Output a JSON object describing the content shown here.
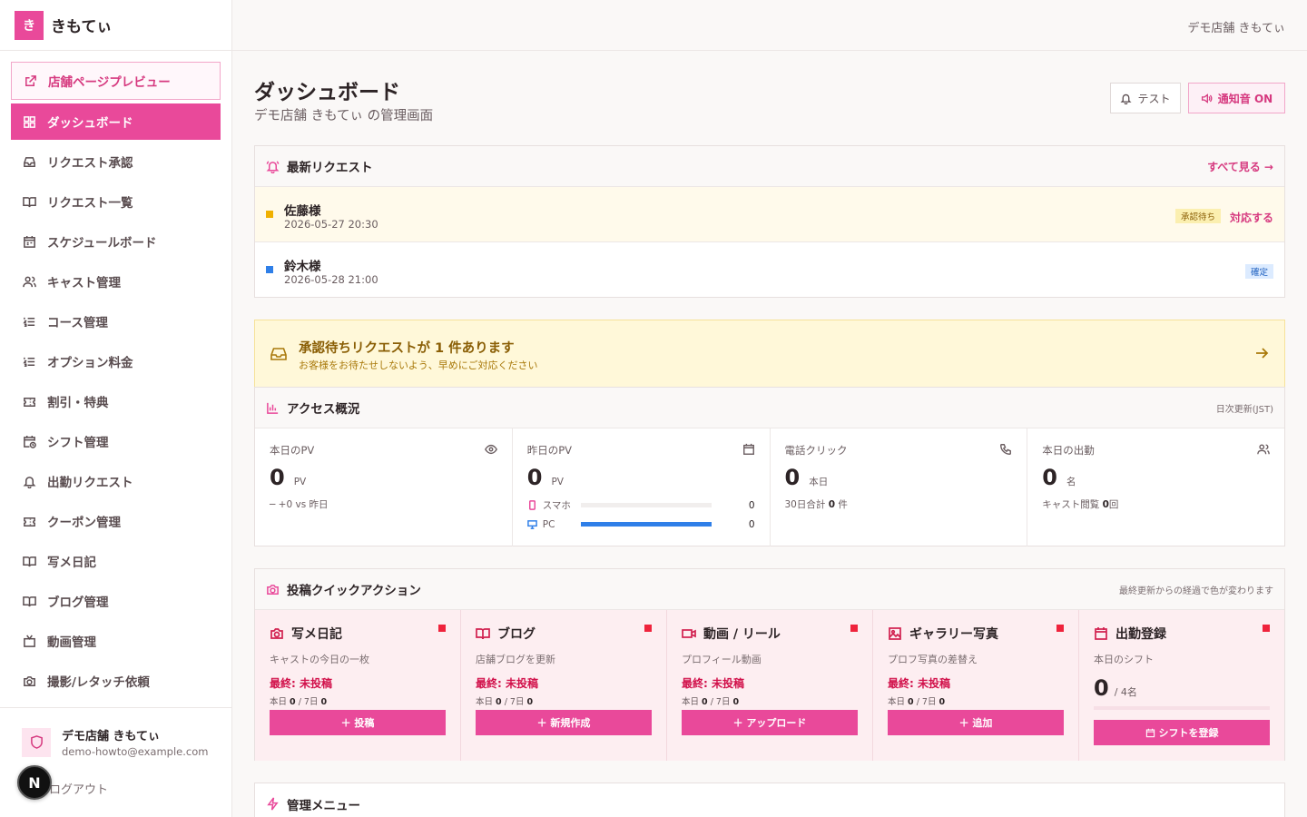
{
  "brand": {
    "logo_char": "き",
    "name": "きもてぃ"
  },
  "sidebar": {
    "items": [
      {
        "label": "店舗ページプレビュー",
        "icon": "external-link-icon"
      },
      {
        "label": "ダッシュボード",
        "icon": "grid-icon"
      },
      {
        "label": "リクエスト承認",
        "icon": "inbox-icon"
      },
      {
        "label": "リクエスト一覧",
        "icon": "book-icon"
      },
      {
        "label": "スケジュールボード",
        "icon": "calendar-icon"
      },
      {
        "label": "キャスト管理",
        "icon": "users-icon"
      },
      {
        "label": "コース管理",
        "icon": "list-icon"
      },
      {
        "label": "オプション料金",
        "icon": "list-icon"
      },
      {
        "label": "割引・特典",
        "icon": "ticket-icon"
      },
      {
        "label": "シフト管理",
        "icon": "calendar-clock-icon"
      },
      {
        "label": "出勤リクエスト",
        "icon": "bell-icon"
      },
      {
        "label": "クーポン管理",
        "icon": "ticket-icon"
      },
      {
        "label": "写メ日記",
        "icon": "book-icon"
      },
      {
        "label": "ブログ管理",
        "icon": "book-icon"
      },
      {
        "label": "動画管理",
        "icon": "tv-icon"
      },
      {
        "label": "撮影/レタッチ依頼",
        "icon": "camera-icon"
      }
    ],
    "account": {
      "name": "デモ店舗 きもてぃ",
      "email": "demo-howto@example.com"
    },
    "logout": "ログアウト",
    "badge": "N"
  },
  "topbar": {
    "shop_name": "デモ店舗 きもてぃ"
  },
  "header": {
    "title": "ダッシュボード",
    "subtitle": "デモ店舗 きもてぃ の管理画面",
    "test_button": "テスト",
    "sound_button": "通知音 ON"
  },
  "requests": {
    "title": "最新リクエスト",
    "see_all": "すべて見る →",
    "rows": [
      {
        "name": "佐藤様",
        "datetime": "2026-05-27 20:30",
        "status": "承認待ち",
        "action": "対応する",
        "dot_color": "#f0b000"
      },
      {
        "name": "鈴木様",
        "datetime": "2026-05-28 21:00",
        "status": "確定",
        "action": "",
        "dot_color": "#2f7fe8"
      }
    ]
  },
  "alert": {
    "title": "承認待ちリクエストが 1 件あります",
    "subtitle": "お客様をお待たせしないよう、早めにご対応ください"
  },
  "access": {
    "title": "アクセス概況",
    "note": "日次更新(JST)",
    "today_pv": {
      "label": "本日のPV",
      "value": "0",
      "unit": "PV",
      "foot": "─ +0 vs 昨日"
    },
    "yesterday_pv": {
      "label": "昨日のPV",
      "value": "0",
      "unit": "PV",
      "devices": [
        {
          "label": "スマホ",
          "value": "0",
          "fill": 0
        },
        {
          "label": "PC",
          "value": "0",
          "fill": 1
        }
      ]
    },
    "phone_click": {
      "label": "電話クリック",
      "value": "0",
      "unit": "本日",
      "foot_prefix": "30日合計",
      "foot_value": "0",
      "foot_suffix": "件"
    },
    "attendance": {
      "label": "本日の出勤",
      "value": "0",
      "unit": "名",
      "foot_prefix": "キャスト閲覧",
      "foot_value": "0",
      "foot_suffix": "回"
    }
  },
  "quick": {
    "title": "投稿クイックアクション",
    "note": "最終更新からの経過で色が変わります",
    "items": [
      {
        "title": "写メ日記",
        "sub": "キャストの今日の一枚",
        "last": "最終: 未投稿",
        "today_label": "本日",
        "today": "0",
        "week_label": "7日",
        "week": "0",
        "button": "＋ 投稿"
      },
      {
        "title": "ブログ",
        "sub": "店舗ブログを更新",
        "last": "最終: 未投稿",
        "today_label": "本日",
        "today": "0",
        "week_label": "7日",
        "week": "0",
        "button": "＋ 新規作成"
      },
      {
        "title": "動画 / リール",
        "sub": "プロフィール動画",
        "last": "最終: 未投稿",
        "today_label": "本日",
        "today": "0",
        "week_label": "7日",
        "week": "0",
        "button": "＋ アップロード"
      },
      {
        "title": "ギャラリー写真",
        "sub": "プロフ写真の差替え",
        "last": "最終: 未投稿",
        "today_label": "本日",
        "today": "0",
        "week_label": "7日",
        "week": "0",
        "button": "＋ 追加"
      }
    ],
    "shift": {
      "title": "出勤登録",
      "sub": "本日のシフト",
      "value": "0",
      "unit": "/ 4名",
      "button": "シフトを登録"
    }
  },
  "admin_menu": {
    "title": "管理メニュー"
  },
  "colors": {
    "accent": "#e9499a",
    "warning": "#f0b000",
    "info": "#2f7fe8",
    "danger": "#ef233c"
  }
}
